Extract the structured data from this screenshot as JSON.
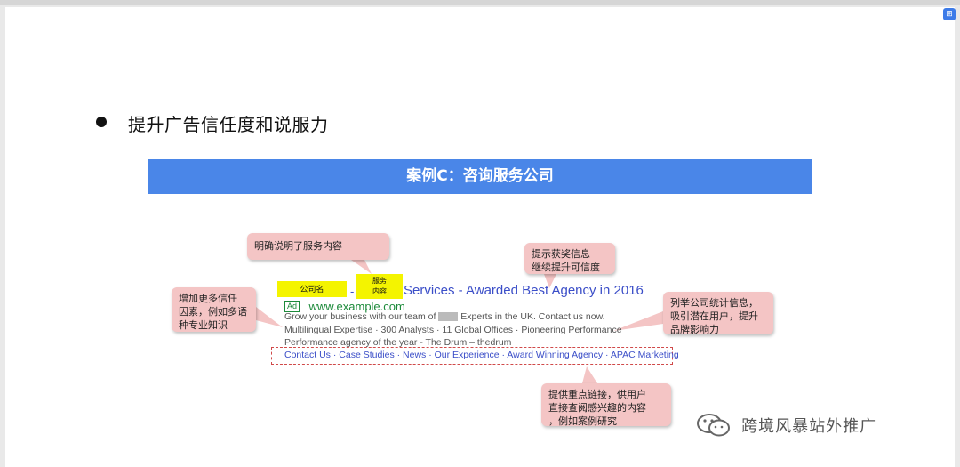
{
  "heading": "提升广告信任度和说服力",
  "banner": "案例C：咨询服务公司",
  "ad": {
    "label_company": "公司名",
    "label_service_line1": "服务",
    "label_service_line2": "内容",
    "dash": "-",
    "title": "Services - Awarded Best Agency in 2016",
    "badge": "Ad",
    "url": "www.example.com",
    "desc1_before": "Grow your business with our team of",
    "desc1_after": "Experts in the UK. Contact us now.",
    "desc2": "Multilingual Expertise · 300 Analysts · 11 Global Offices · Pioneering Performance",
    "desc3": "Performance agency of the year - The Drum – thedrum",
    "links": "Contact Us · Case Studies · News · Our Experience · Award Winning Agency · APAC Marketing"
  },
  "callouts": {
    "service": "明确说明了服务内容",
    "award": "提示获奖信息\n继续提升可信度",
    "trust": "增加更多信任\n因素，例如多语\n种专业知识",
    "stats": "列举公司统计信息，\n吸引潜在用户，提升\n品牌影响力",
    "links": "提供重点链接，供用户\n直接查阅感兴趣的内容\n，例如案例研究"
  },
  "watermark": "跨境风暴站外推广",
  "corner_icon": "translate-icon",
  "colors": {
    "banner": "#4a86e8",
    "callout": "#f4c5c5",
    "highlight": "#f4f400",
    "ad_title": "#3b4ec8",
    "ad_url": "#1c8a3a",
    "dashed_border": "#d04a4a"
  }
}
